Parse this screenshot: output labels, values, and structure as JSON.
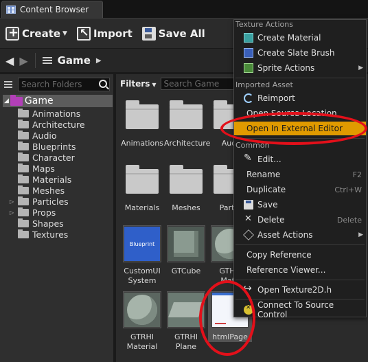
{
  "window": {
    "tab_title": "Content Browser"
  },
  "toolbar": {
    "create_label": "Create",
    "import_label": "Import",
    "save_all_label": "Save All"
  },
  "path": {
    "current": "Game"
  },
  "left_panel": {
    "search_placeholder": "Search Folders",
    "root": "Game",
    "folders": [
      {
        "label": "Animations",
        "expandable": false
      },
      {
        "label": "Architecture",
        "expandable": false
      },
      {
        "label": "Audio",
        "expandable": false
      },
      {
        "label": "Blueprints",
        "expandable": false
      },
      {
        "label": "Character",
        "expandable": false
      },
      {
        "label": "Maps",
        "expandable": false
      },
      {
        "label": "Materials",
        "expandable": false
      },
      {
        "label": "Meshes",
        "expandable": false
      },
      {
        "label": "Particles",
        "expandable": true
      },
      {
        "label": "Props",
        "expandable": true
      },
      {
        "label": "Shapes",
        "expandable": false
      },
      {
        "label": "Textures",
        "expandable": false
      }
    ]
  },
  "right_panel": {
    "filters_label": "Filters",
    "search_placeholder": "Search Game",
    "assets": [
      {
        "label": "Animations",
        "kind": "folder"
      },
      {
        "label": "Architecture",
        "kind": "folder"
      },
      {
        "label": "Audi",
        "kind": "folder"
      },
      {
        "label": "Materials",
        "kind": "folder"
      },
      {
        "label": "Meshes",
        "kind": "folder"
      },
      {
        "label": "Partic",
        "kind": "folder"
      },
      {
        "label": "CustomUI System",
        "line1": "CustomUI",
        "line2": "System",
        "kind": "blueprint",
        "thumb_text": "Blueprint"
      },
      {
        "label": "GTCube",
        "kind": "cube"
      },
      {
        "label": "GTHU Mate",
        "line1": "GTHU",
        "line2": "Mate",
        "kind": "sphere"
      },
      {
        "label": "GTRHI Material",
        "line1": "GTRHI",
        "line2": "Material",
        "kind": "sphere"
      },
      {
        "label": "GTRHI Plane",
        "line1": "GTRHI",
        "line2": "Plane",
        "kind": "plane"
      },
      {
        "label": "htmlPage",
        "kind": "texture",
        "selected": true
      }
    ]
  },
  "context_menu": {
    "section_texture": "Texture Actions",
    "create_material": "Create Material",
    "create_slate_brush": "Create Slate Brush",
    "sprite_actions": "Sprite Actions",
    "section_imported": "Imported Asset",
    "reimport": "Reimport",
    "open_source_location": "Open Source Location",
    "open_external_editor": "Open In External Editor",
    "section_common": "Common",
    "edit": "Edit...",
    "rename": "Rename",
    "rename_shortcut": "F2",
    "duplicate": "Duplicate",
    "duplicate_shortcut": "Ctrl+W",
    "save": "Save",
    "delete": "Delete",
    "delete_shortcut": "Delete",
    "asset_actions": "Asset Actions",
    "copy_reference": "Copy Reference",
    "reference_viewer": "Reference Viewer...",
    "open_header": "Open Texture2D.h",
    "connect_source_control": "Connect To Source Control"
  },
  "colors": {
    "highlight": "#e09a00",
    "annotation_red": "#e3101a",
    "root_folder": "#b23fb8"
  }
}
